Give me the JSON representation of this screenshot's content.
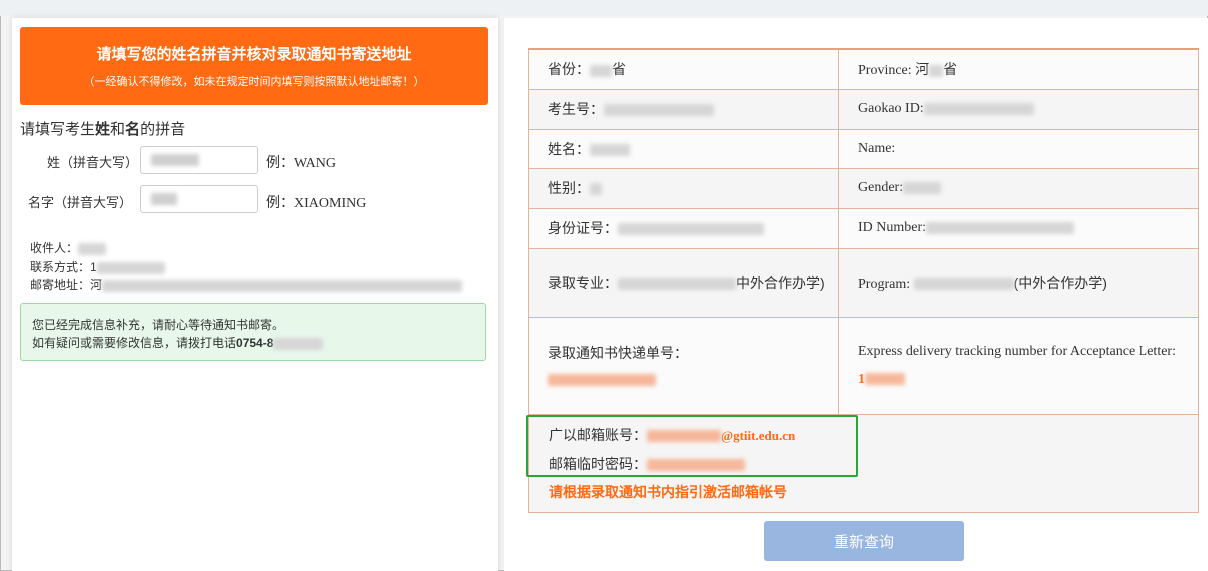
{
  "banner": {
    "title": "请填写您的姓名拼音并核对录取通知书寄送地址",
    "subtitle": "（一经确认不得修改，如未在规定时间内填写则按照默认地址邮寄！）"
  },
  "name_section": {
    "title_pre": "请填写考生",
    "title_xing": "姓",
    "title_he": "和",
    "title_ming": "名",
    "title_post": "的拼音",
    "surname_label": "姓（拼音大写）",
    "surname_example": "例：WANG",
    "given_label": "名字（拼音大写）",
    "given_example": "例：XIAOMING"
  },
  "contact": {
    "recipient_label": "收件人：",
    "phone_label": "联系方式：1",
    "address_label": "邮寄地址：河"
  },
  "notice": {
    "line1": "您已经完成信息补充，请耐心等待通知书邮寄。",
    "line2_pre": "如有疑问或需要修改信息，请拨打电话",
    "line2_phone": "0754-8"
  },
  "table": {
    "province_cn": "省份：",
    "province_cn_suffix": "省",
    "province_en": "Province: 河",
    "province_en_suffix": "省",
    "gaokao_cn": "考生号：",
    "gaokao_en": "Gaokao ID:",
    "name_cn": "姓名：",
    "name_en": "Name:",
    "gender_cn": "性别：",
    "gender_en": "Gender:",
    "id_cn": "身份证号：",
    "id_en": "ID Number:",
    "program_cn_pre": "录取专业：",
    "program_cn_post": "中外合作办学)",
    "program_en_pre": "Program:",
    "program_en_post": "(中外合作办学)",
    "express_cn": "录取通知书快递单号：",
    "express_en": "Express delivery tracking number for Acceptance Letter:",
    "express_en_prefix": "1"
  },
  "mail": {
    "account_label": "广以邮箱账号：",
    "account_domain": "@gtiit.edu.cn",
    "password_label": "邮箱临时密码：",
    "activate_text": "请根据录取通知书内指引激活邮箱帐号"
  },
  "requery_button": "重新查询",
  "colors": {
    "accent": "#ff6a12",
    "success_border": "#2aa637",
    "button": "#98b6e0"
  }
}
